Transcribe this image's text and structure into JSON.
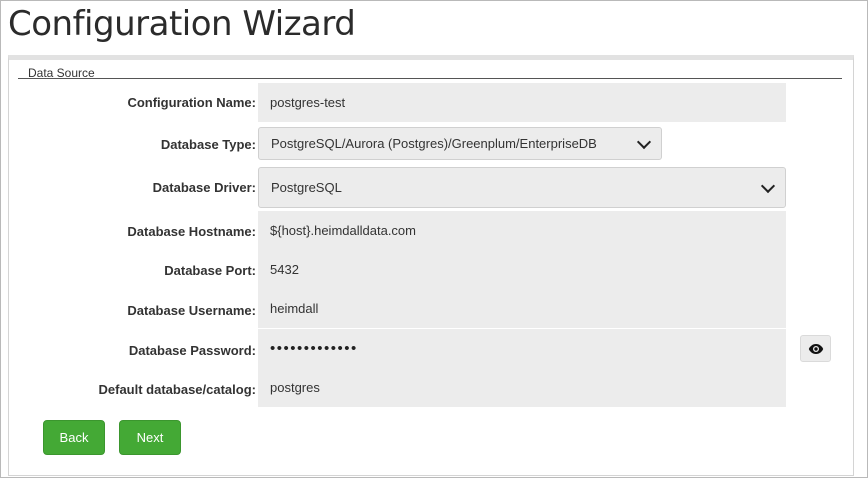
{
  "header": {
    "title": "Configuration Wizard"
  },
  "section": {
    "legend": "Data Source"
  },
  "form": {
    "config_name": {
      "label": "Configuration Name:",
      "value": "postgres-test"
    },
    "db_type": {
      "label": "Database Type:",
      "value": "PostgreSQL/Aurora (Postgres)/Greenplum/EnterpriseDB"
    },
    "db_driver": {
      "label": "Database Driver:",
      "value": "PostgreSQL"
    },
    "db_hostname": {
      "label": "Database Hostname:",
      "value": "${host}.heimdalldata.com"
    },
    "db_port": {
      "label": "Database Port:",
      "value": "5432"
    },
    "db_username": {
      "label": "Database Username:",
      "value": "heimdall"
    },
    "db_password": {
      "label": "Database Password:",
      "value": "•••••••••••••"
    },
    "default_db": {
      "label": "Default database/catalog:",
      "value": "postgres"
    }
  },
  "buttons": {
    "back": "Back",
    "next": "Next"
  },
  "icons": {
    "password_toggle": "eye-icon",
    "dropdown": "chevron-down-icon"
  },
  "colors": {
    "primary_button": "#44a935",
    "field_background": "#ececec"
  }
}
